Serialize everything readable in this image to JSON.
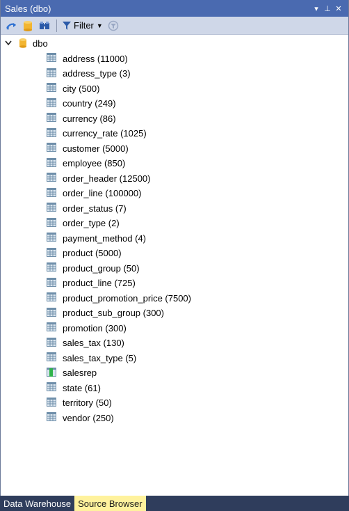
{
  "window": {
    "title": "Sales (dbo)",
    "pin_glyph": "▾ ⊥ ✕"
  },
  "toolbar": {
    "filter_label": "Filter"
  },
  "tree": {
    "root_label": "dbo",
    "items": [
      {
        "label": "address (11000)"
      },
      {
        "label": "address_type (3)"
      },
      {
        "label": "city (500)"
      },
      {
        "label": "country (249)"
      },
      {
        "label": "currency (86)"
      },
      {
        "label": "currency_rate (1025)"
      },
      {
        "label": "customer (5000)"
      },
      {
        "label": "employee (850)"
      },
      {
        "label": "order_header (12500)"
      },
      {
        "label": "order_line (100000)"
      },
      {
        "label": "order_status (7)"
      },
      {
        "label": "order_type (2)"
      },
      {
        "label": "payment_method (4)"
      },
      {
        "label": "product (5000)"
      },
      {
        "label": "product_group (50)"
      },
      {
        "label": "product_line (725)"
      },
      {
        "label": "product_promotion_price (7500)"
      },
      {
        "label": "product_sub_group (300)"
      },
      {
        "label": "promotion (300)"
      },
      {
        "label": "sales_tax (130)"
      },
      {
        "label": "sales_tax_type (5)"
      },
      {
        "label": "salesrep",
        "icon": "view-icon"
      },
      {
        "label": "state (61)"
      },
      {
        "label": "territory (50)"
      },
      {
        "label": "vendor (250)"
      }
    ]
  },
  "tabs": [
    {
      "label": "Data Warehouse",
      "active": false
    },
    {
      "label": "Source Browser",
      "active": true
    }
  ],
  "colors": {
    "titlebar": "#4a6ab0",
    "toolbar": "#cfd7e8",
    "active_tab": "#fff29d",
    "tab_strip": "#2f3d5c"
  }
}
